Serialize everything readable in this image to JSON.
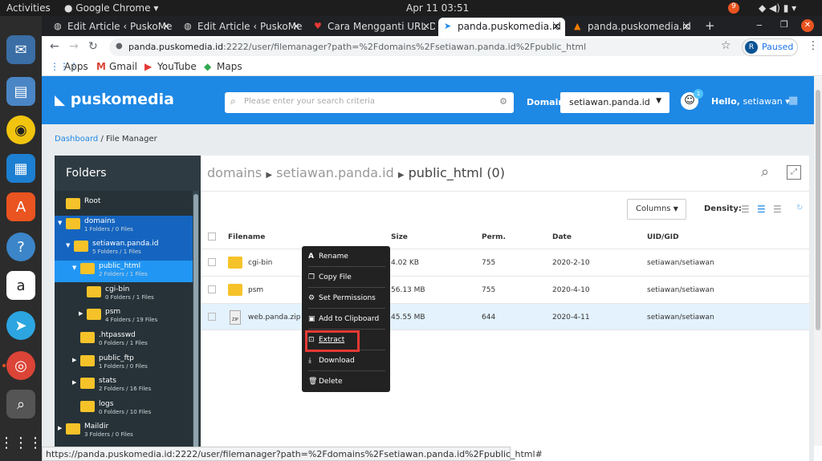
{
  "system": {
    "activities": "Activities",
    "app": "Google Chrome",
    "datetime": "Apr 11  03:51",
    "notif_count": "9"
  },
  "tabs": [
    {
      "label": "Edit Article ‹ PuskoMe",
      "active": false
    },
    {
      "label": "Edit Article ‹ PuskoMe",
      "active": false
    },
    {
      "label": "Cara Mengganti URL D",
      "active": false
    },
    {
      "label": "panda.puskomedia.id",
      "active": true
    },
    {
      "label": "panda.puskomedia.id",
      "active": false
    }
  ],
  "toolbar": {
    "url_host": "panda.puskomedia.id",
    "url_rest": ":2222/user/filemanager?path=%2Fdomains%2Fsetiawan.panda.id%2Fpublic_html",
    "profile_initial": "R",
    "profile_status": "Paused"
  },
  "bookmarks": [
    "Apps",
    "Gmail",
    "YouTube",
    "Maps"
  ],
  "header": {
    "logo": "puskomedia",
    "search_placeholder": "Please enter your search criteria",
    "domain_label": "Domain",
    "domain_value": "setiawan.panda.id",
    "notif_badge": "1",
    "hello_prefix": "Hello,",
    "hello_user": "setiawan"
  },
  "breadcrumb": {
    "link": "Dashboard",
    "current": "/ File Manager"
  },
  "sidebar": {
    "title": "Folders",
    "nodes": [
      {
        "name": "Root",
        "info": ""
      },
      {
        "name": "domains",
        "info": "1 Folders / 0 Files"
      },
      {
        "name": "setiawan.panda.id",
        "info": "5 Folders / 1 Files"
      },
      {
        "name": "public_html",
        "info": "2 Folders / 1 Files"
      },
      {
        "name": "cgi-bin",
        "info": "0 Folders / 1 Files"
      },
      {
        "name": "psm",
        "info": "4 Folders / 19 Files"
      },
      {
        "name": ".htpasswd",
        "info": "0 Folders / 1 Files"
      },
      {
        "name": "public_ftp",
        "info": "1 Folders / 0 Files"
      },
      {
        "name": "stats",
        "info": "2 Folders / 16 Files"
      },
      {
        "name": "logs",
        "info": "0 Folders / 10 Files"
      },
      {
        "name": "Maildir",
        "info": "3 Folders / 0 Files"
      }
    ]
  },
  "main": {
    "path": [
      "domains",
      "setiawan.panda.id",
      "public_html"
    ],
    "count": "(0)",
    "columns_button": "Columns",
    "density_label": "Density:",
    "headers": [
      "Filename",
      "Size",
      "Perm.",
      "Date",
      "UID/GID"
    ],
    "rows": [
      {
        "name": "cgi-bin",
        "size": "4.02 KB",
        "perm": "755",
        "date": "2020-2-10",
        "uid": "setiawan/setiawan"
      },
      {
        "name": "psm",
        "size": "56.13 MB",
        "perm": "755",
        "date": "2020-4-10",
        "uid": "setiawan/setiawan"
      },
      {
        "name": "web.panda.zip",
        "size": "45.55 MB",
        "perm": "644",
        "date": "2020-4-11",
        "uid": "setiawan/setiawan"
      }
    ]
  },
  "context_menu": [
    "Rename",
    "Copy File",
    "Set Permissions",
    "Add to Clipboard",
    "Extract",
    "Download",
    "Delete"
  ],
  "status_url": "https://panda.puskomedia.id:2222/user/filemanager?path=%2Fdomains%2Fsetiawan.panda.id%2Fpublic_html#",
  "colors": {
    "brand": "#1e88e5",
    "sidebar": "#263238",
    "highlight": "#e53935"
  }
}
